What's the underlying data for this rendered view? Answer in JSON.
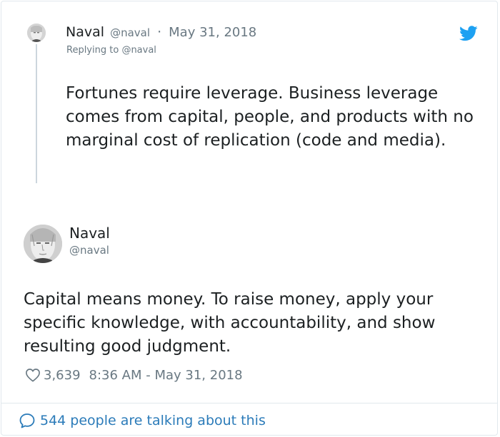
{
  "parent_tweet": {
    "author_name": "Naval",
    "handle": "@naval",
    "separator": "·",
    "date": "May 31, 2018",
    "replying_prefix": "Replying to",
    "replying_to": "@naval",
    "text": "Fortunes require leverage. Business leverage comes from capital, people, and products with no marginal cost of replication (code and media).",
    "icon": "twitter-bird-icon"
  },
  "main_tweet": {
    "author_name": "Naval",
    "handle": "@naval",
    "text": "Capital means money. To raise money, apply your specific knowledge, with accountability, and show resulting good judgment.",
    "likes": "3,639",
    "timestamp": "8:36 AM - May 31, 2018",
    "like_icon": "heart-icon"
  },
  "footer": {
    "talking_label": "544 people are talking about this",
    "icon": "speech-bubble-icon"
  },
  "colors": {
    "text": "#1c2022",
    "muted": "#697882",
    "link": "#2b7bb9",
    "twitter_blue": "#1da1f2",
    "border": "#e1e8ed"
  }
}
